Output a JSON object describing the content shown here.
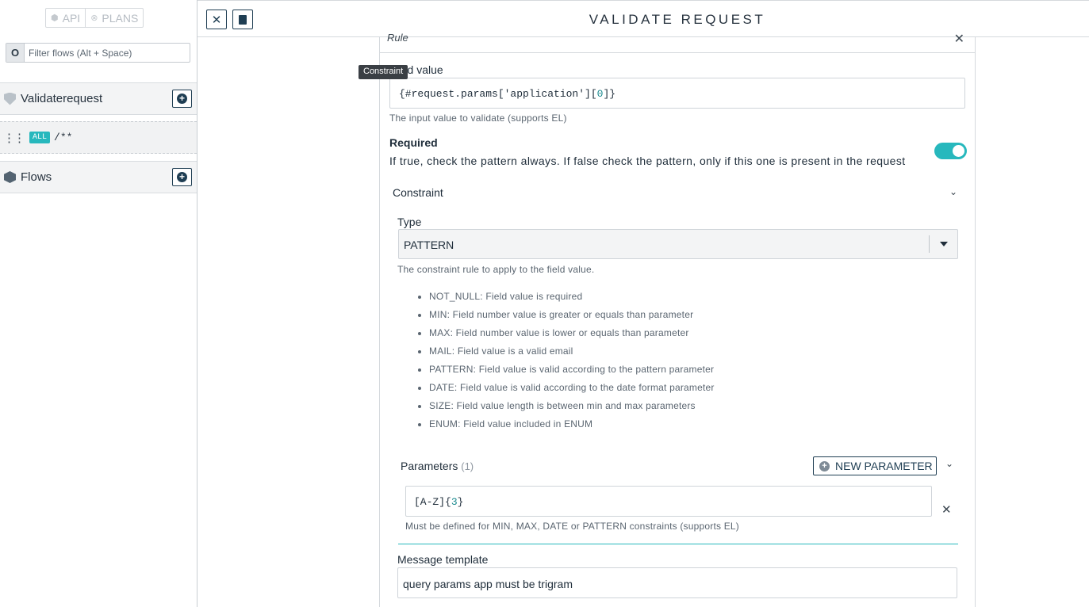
{
  "sidebar": {
    "seg_api": "API",
    "seg_plans": "PLANS",
    "filter_placeholder": "Filter flows (Alt + Space)",
    "section_validate": "Validaterequest",
    "flow_method": "ALL",
    "flow_path": "/**",
    "section_flows": "Flows"
  },
  "header": {
    "title": "VALIDATE REQUEST"
  },
  "rule": {
    "header": "Rule",
    "tooltip": "Constraint",
    "field_label": "Field value",
    "field_value_prefix": "{#request.params['application'][",
    "field_value_index": "0",
    "field_value_suffix": "]}",
    "field_hint": "The input value to validate (supports EL)",
    "required_label": "Required",
    "required_desc": "If true, check the pattern always. If false check the pattern, only if this one is present in the request",
    "required_on": true,
    "constraint_label": "Constraint",
    "type_label": "Type",
    "type_value": "PATTERN",
    "type_hint": "The constraint rule to apply to the field value.",
    "rules": [
      "NOT_NULL: Field value is required",
      "MIN: Field number value is greater or equals than parameter",
      "MAX: Field number value is lower or equals than parameter",
      "MAIL: Field value is a valid email",
      "PATTERN: Field value is valid according to the pattern parameter",
      "DATE: Field value is valid according to the date format parameter",
      "SIZE: Field value length is between min and max parameters",
      "ENUM: Field value included in ENUM"
    ],
    "parameters_label": "Parameters",
    "parameters_count": "(1)",
    "new_parameter": "NEW PARAMETER",
    "param_value_prefix": "[A-Z]{",
    "param_value_num": "3",
    "param_value_suffix": "}",
    "param_hint": "Must be defined for MIN, MAX, DATE or PATTERN constraints (supports EL)",
    "message_label": "Message template",
    "message_value": "query params app must be trigram"
  },
  "colors": {
    "accent": "#27b8bd",
    "primary": "#1f3e53"
  }
}
